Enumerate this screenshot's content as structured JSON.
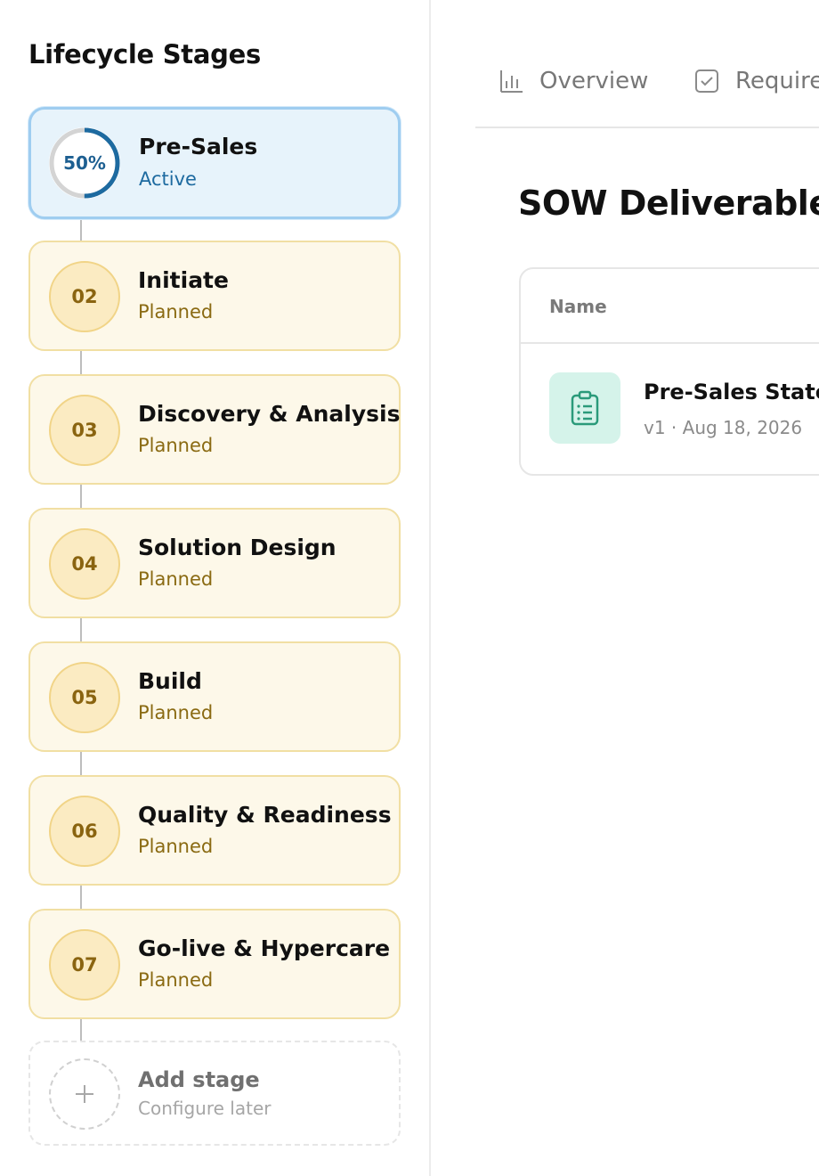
{
  "sidebar": {
    "title": "Lifecycle Stages",
    "active_stage": {
      "progress_label": "50%",
      "progress": 0.5,
      "name": "Pre-Sales",
      "status": "Active"
    },
    "stages": [
      {
        "number": "02",
        "name": "Initiate",
        "status": "Planned"
      },
      {
        "number": "03",
        "name": "Discovery & Analysis",
        "status": "Planned"
      },
      {
        "number": "04",
        "name": "Solution Design",
        "status": "Planned"
      },
      {
        "number": "05",
        "name": "Build",
        "status": "Planned"
      },
      {
        "number": "06",
        "name": "Quality & Readiness",
        "status": "Planned"
      },
      {
        "number": "07",
        "name": "Go-live & Hypercare",
        "status": "Planned"
      }
    ],
    "add_stage": {
      "icon": "plus-icon",
      "label": "Add stage",
      "sublabel": "Configure later"
    }
  },
  "tabs": [
    {
      "label": "Overview",
      "icon": "bar-chart-icon"
    },
    {
      "label": "Requirements",
      "icon": "checkbox-icon"
    }
  ],
  "main": {
    "section_title": "SOW Deliverables",
    "table": {
      "column_name": "Name",
      "rows": [
        {
          "icon": "clipboard-icon",
          "title": "Pre-Sales Statement of Work",
          "meta": "v1 · Aug 18, 2026"
        }
      ]
    }
  },
  "colors": {
    "active_ring": "#1d6aa0",
    "planned_bg": "#fdf8e9",
    "active_bg": "#e7f3fb",
    "doc_icon_bg": "#d5f3ea"
  }
}
